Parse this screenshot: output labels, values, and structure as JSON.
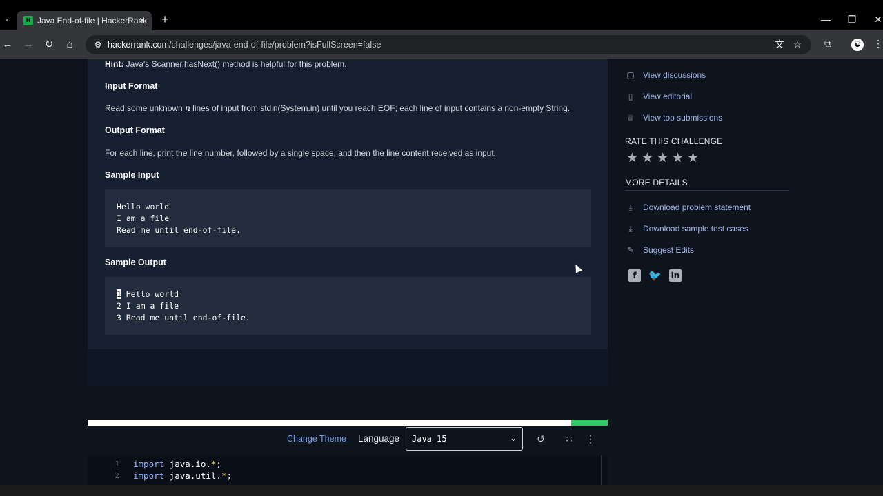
{
  "browser": {
    "tab_title": "Java End-of-file | HackerRank",
    "favicon_text": "H",
    "url_host": "hackerrank.com",
    "url_rest": "/challenges/java-end-of-file/problem?isFullScreen=false"
  },
  "problem": {
    "hint_label": "Hint:",
    "hint_text": " Java's Scanner.hasNext() method is helpful for this problem.",
    "input_format_title": "Input Format",
    "input_format_pre": "Read some unknown ",
    "input_format_var": "n",
    "input_format_post": " lines of input from stdin(System.in) until you reach EOF; each line of input contains a non-empty String.",
    "output_format_title": "Output Format",
    "output_format_text": "For each line, print the line number, followed by a single space, and then the line content received as input.",
    "sample_input_title": "Sample Input",
    "sample_input_lines": [
      "Hello world",
      "I am a file",
      "Read me until end-of-file."
    ],
    "sample_output_title": "Sample Output",
    "sample_output_first_num": "1",
    "sample_output_first_rest": " Hello world",
    "sample_output_lines": [
      "2 I am a file",
      "3 Read me until end-of-file."
    ]
  },
  "sidebar": {
    "links_top": [
      {
        "label": "View discussions",
        "icon": "chat-icon"
      },
      {
        "label": "View editorial",
        "icon": "book-icon"
      },
      {
        "label": "View top submissions",
        "icon": "trophy-icon"
      }
    ],
    "rate_title": "RATE THIS CHALLENGE",
    "stars_count": 5,
    "more_details_title": "MORE DETAILS",
    "links_bottom": [
      {
        "label": "Download problem statement",
        "icon": "download-icon"
      },
      {
        "label": "Download sample test cases",
        "icon": "download-icon"
      },
      {
        "label": "Suggest Edits",
        "icon": "pencil-icon"
      }
    ],
    "social": [
      "facebook-icon",
      "twitter-icon",
      "linkedin-icon"
    ]
  },
  "editor": {
    "progress_fraction": 0.93,
    "change_theme": "Change Theme",
    "language_label": "Language",
    "language_value": "Java 15",
    "lines": [
      {
        "num": "1",
        "kw": "import",
        "pkg": " java.io.",
        "star": "*",
        "semi": ";"
      },
      {
        "num": "2",
        "kw": "import",
        "pkg": " java.util.",
        "star": "*",
        "semi": ";"
      }
    ]
  },
  "colors": {
    "page_bg": "#0e141e",
    "panel_bg": "#172031",
    "link": "#9fb4e8",
    "accent_green": "#2ec866"
  }
}
